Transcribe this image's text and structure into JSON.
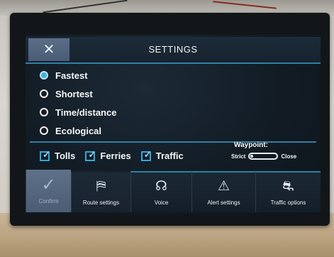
{
  "header": {
    "title": "SETTINGS",
    "close_icon": "✕"
  },
  "route_types": [
    {
      "label": "Fastest",
      "selected": true
    },
    {
      "label": "Shortest",
      "selected": false
    },
    {
      "label": "Time/distance",
      "selected": false
    },
    {
      "label": "Ecological",
      "selected": false
    }
  ],
  "options": [
    {
      "label": "Tolls",
      "checked": true
    },
    {
      "label": "Ferries",
      "checked": true
    },
    {
      "label": "Traffic",
      "checked": true
    }
  ],
  "waypoint": {
    "label": "Waypoint:",
    "left": "Strict",
    "right": "Close",
    "value": "Strict"
  },
  "tabs": [
    {
      "label": "Confirm",
      "icon": "checkmark-icon",
      "glyph": "✓"
    },
    {
      "label": "Route settings",
      "icon": "route-settings-icon",
      "glyph": "⛿"
    },
    {
      "label": "Voice",
      "icon": "voice-icon",
      "glyph": "☊"
    },
    {
      "label": "Alert settings",
      "icon": "warning-icon",
      "glyph": "⚠"
    },
    {
      "label": "Traffic options",
      "icon": "traffic-icon",
      "glyph": "⛐"
    }
  ],
  "colors": {
    "accent": "#2f80a3",
    "radio_selected": "#3fb1df",
    "confirm_button": "#5b6e88",
    "screen_bg": "#121b24"
  }
}
